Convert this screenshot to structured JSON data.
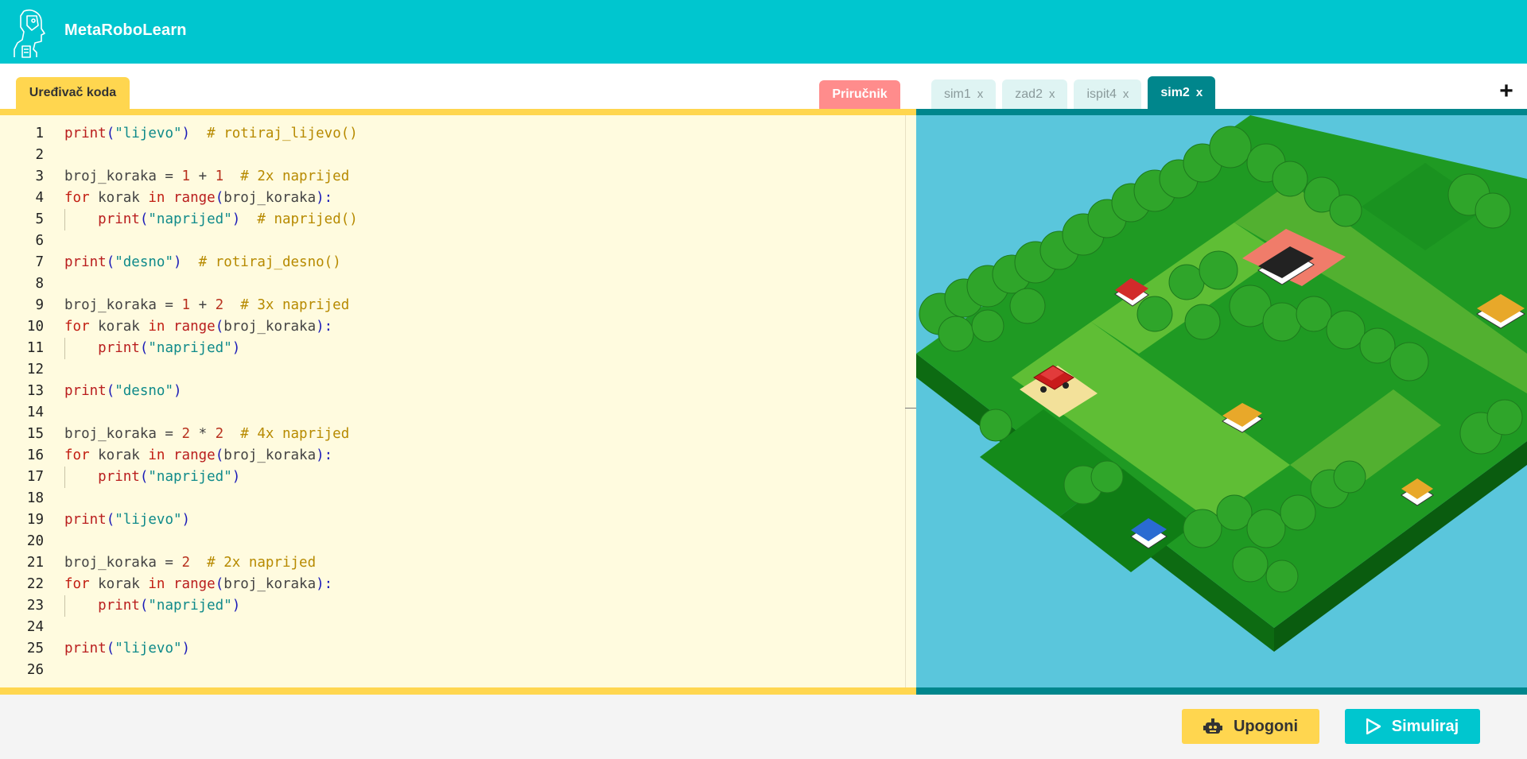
{
  "app": {
    "brand": "MetaRoboLearn"
  },
  "tabs": {
    "editor_label": "Uređivač koda",
    "manual_label": "Priručnik",
    "sims": [
      {
        "label": "sim1",
        "close": "x"
      },
      {
        "label": "zad2",
        "close": "x"
      },
      {
        "label": "ispit4",
        "close": "x"
      },
      {
        "label": "sim2",
        "close": "x",
        "active": true
      }
    ],
    "add_label": "+"
  },
  "code": {
    "lines": [
      {
        "n": "1",
        "tokens": [
          {
            "t": "print",
            "c": "builtin"
          },
          {
            "t": "(",
            "c": "punc"
          },
          {
            "t": "\"lijevo\"",
            "c": "str"
          },
          {
            "t": ")",
            "c": "punc"
          },
          {
            "t": "  # rotiraj_lijevo()",
            "c": "com"
          }
        ]
      },
      {
        "n": "2",
        "tokens": []
      },
      {
        "n": "3",
        "tokens": [
          {
            "t": "broj_koraka = ",
            "c": "var"
          },
          {
            "t": "1",
            "c": "num"
          },
          {
            "t": " + ",
            "c": "var"
          },
          {
            "t": "1",
            "c": "num"
          },
          {
            "t": "  # 2x naprijed",
            "c": "com"
          }
        ]
      },
      {
        "n": "4",
        "tokens": [
          {
            "t": "for",
            "c": "kw"
          },
          {
            "t": " korak ",
            "c": "var"
          },
          {
            "t": "in",
            "c": "kw"
          },
          {
            "t": " ",
            "c": "var"
          },
          {
            "t": "range",
            "c": "builtin"
          },
          {
            "t": "(",
            "c": "punc"
          },
          {
            "t": "broj_koraka",
            "c": "var"
          },
          {
            "t": "):",
            "c": "punc"
          }
        ]
      },
      {
        "n": "5",
        "indent": true,
        "tokens": [
          {
            "t": "print",
            "c": "builtin"
          },
          {
            "t": "(",
            "c": "punc"
          },
          {
            "t": "\"naprijed\"",
            "c": "str"
          },
          {
            "t": ")",
            "c": "punc"
          },
          {
            "t": "  # naprijed()",
            "c": "com"
          }
        ]
      },
      {
        "n": "6",
        "tokens": []
      },
      {
        "n": "7",
        "tokens": [
          {
            "t": "print",
            "c": "builtin"
          },
          {
            "t": "(",
            "c": "punc"
          },
          {
            "t": "\"desno\"",
            "c": "str"
          },
          {
            "t": ")",
            "c": "punc"
          },
          {
            "t": "  # rotiraj_desno()",
            "c": "com"
          }
        ]
      },
      {
        "n": "8",
        "tokens": []
      },
      {
        "n": "9",
        "tokens": [
          {
            "t": "broj_koraka = ",
            "c": "var"
          },
          {
            "t": "1",
            "c": "num"
          },
          {
            "t": " + ",
            "c": "var"
          },
          {
            "t": "2",
            "c": "num"
          },
          {
            "t": "  # 3x naprijed",
            "c": "com"
          }
        ]
      },
      {
        "n": "10",
        "tokens": [
          {
            "t": "for",
            "c": "kw"
          },
          {
            "t": " korak ",
            "c": "var"
          },
          {
            "t": "in",
            "c": "kw"
          },
          {
            "t": " ",
            "c": "var"
          },
          {
            "t": "range",
            "c": "builtin"
          },
          {
            "t": "(",
            "c": "punc"
          },
          {
            "t": "broj_koraka",
            "c": "var"
          },
          {
            "t": "):",
            "c": "punc"
          }
        ]
      },
      {
        "n": "11",
        "indent": true,
        "tokens": [
          {
            "t": "print",
            "c": "builtin"
          },
          {
            "t": "(",
            "c": "punc"
          },
          {
            "t": "\"naprijed\"",
            "c": "str"
          },
          {
            "t": ")",
            "c": "punc"
          }
        ]
      },
      {
        "n": "12",
        "tokens": []
      },
      {
        "n": "13",
        "tokens": [
          {
            "t": "print",
            "c": "builtin"
          },
          {
            "t": "(",
            "c": "punc"
          },
          {
            "t": "\"desno\"",
            "c": "str"
          },
          {
            "t": ")",
            "c": "punc"
          }
        ]
      },
      {
        "n": "14",
        "tokens": []
      },
      {
        "n": "15",
        "tokens": [
          {
            "t": "broj_koraka = ",
            "c": "var"
          },
          {
            "t": "2",
            "c": "num"
          },
          {
            "t": " * ",
            "c": "var"
          },
          {
            "t": "2",
            "c": "num"
          },
          {
            "t": "  # 4x naprijed",
            "c": "com"
          }
        ]
      },
      {
        "n": "16",
        "tokens": [
          {
            "t": "for",
            "c": "kw"
          },
          {
            "t": " korak ",
            "c": "var"
          },
          {
            "t": "in",
            "c": "kw"
          },
          {
            "t": " ",
            "c": "var"
          },
          {
            "t": "range",
            "c": "builtin"
          },
          {
            "t": "(",
            "c": "punc"
          },
          {
            "t": "broj_koraka",
            "c": "var"
          },
          {
            "t": "):",
            "c": "punc"
          }
        ]
      },
      {
        "n": "17",
        "indent": true,
        "tokens": [
          {
            "t": "print",
            "c": "builtin"
          },
          {
            "t": "(",
            "c": "punc"
          },
          {
            "t": "\"naprijed\"",
            "c": "str"
          },
          {
            "t": ")",
            "c": "punc"
          }
        ]
      },
      {
        "n": "18",
        "tokens": []
      },
      {
        "n": "19",
        "tokens": [
          {
            "t": "print",
            "c": "builtin"
          },
          {
            "t": "(",
            "c": "punc"
          },
          {
            "t": "\"lijevo\"",
            "c": "str"
          },
          {
            "t": ")",
            "c": "punc"
          }
        ]
      },
      {
        "n": "20",
        "tokens": []
      },
      {
        "n": "21",
        "tokens": [
          {
            "t": "broj_koraka = ",
            "c": "var"
          },
          {
            "t": "2",
            "c": "num"
          },
          {
            "t": "  # 2x naprijed",
            "c": "com"
          }
        ]
      },
      {
        "n": "22",
        "tokens": [
          {
            "t": "for",
            "c": "kw"
          },
          {
            "t": " korak ",
            "c": "var"
          },
          {
            "t": "in",
            "c": "kw"
          },
          {
            "t": " ",
            "c": "var"
          },
          {
            "t": "range",
            "c": "builtin"
          },
          {
            "t": "(",
            "c": "punc"
          },
          {
            "t": "broj_koraka",
            "c": "var"
          },
          {
            "t": "):",
            "c": "punc"
          }
        ]
      },
      {
        "n": "23",
        "indent": true,
        "tokens": [
          {
            "t": "print",
            "c": "builtin"
          },
          {
            "t": "(",
            "c": "punc"
          },
          {
            "t": "\"naprijed\"",
            "c": "str"
          },
          {
            "t": ")",
            "c": "punc"
          }
        ]
      },
      {
        "n": "24",
        "tokens": []
      },
      {
        "n": "25",
        "tokens": [
          {
            "t": "print",
            "c": "builtin"
          },
          {
            "t": "(",
            "c": "punc"
          },
          {
            "t": "\"lijevo\"",
            "c": "str"
          },
          {
            "t": ")",
            "c": "punc"
          }
        ]
      },
      {
        "n": "26",
        "tokens": []
      }
    ]
  },
  "footer": {
    "run_label": "Upogoni",
    "run_icon": "robot-icon",
    "simulate_label": "Simuliraj",
    "simulate_icon": "play-icon"
  },
  "colors": {
    "header": "#00c6cf",
    "editor_accent": "#ffd64f",
    "sim_accent": "#00868c",
    "manual_tab": "#ff8c8c",
    "sim_background": "#5ac6dc"
  }
}
